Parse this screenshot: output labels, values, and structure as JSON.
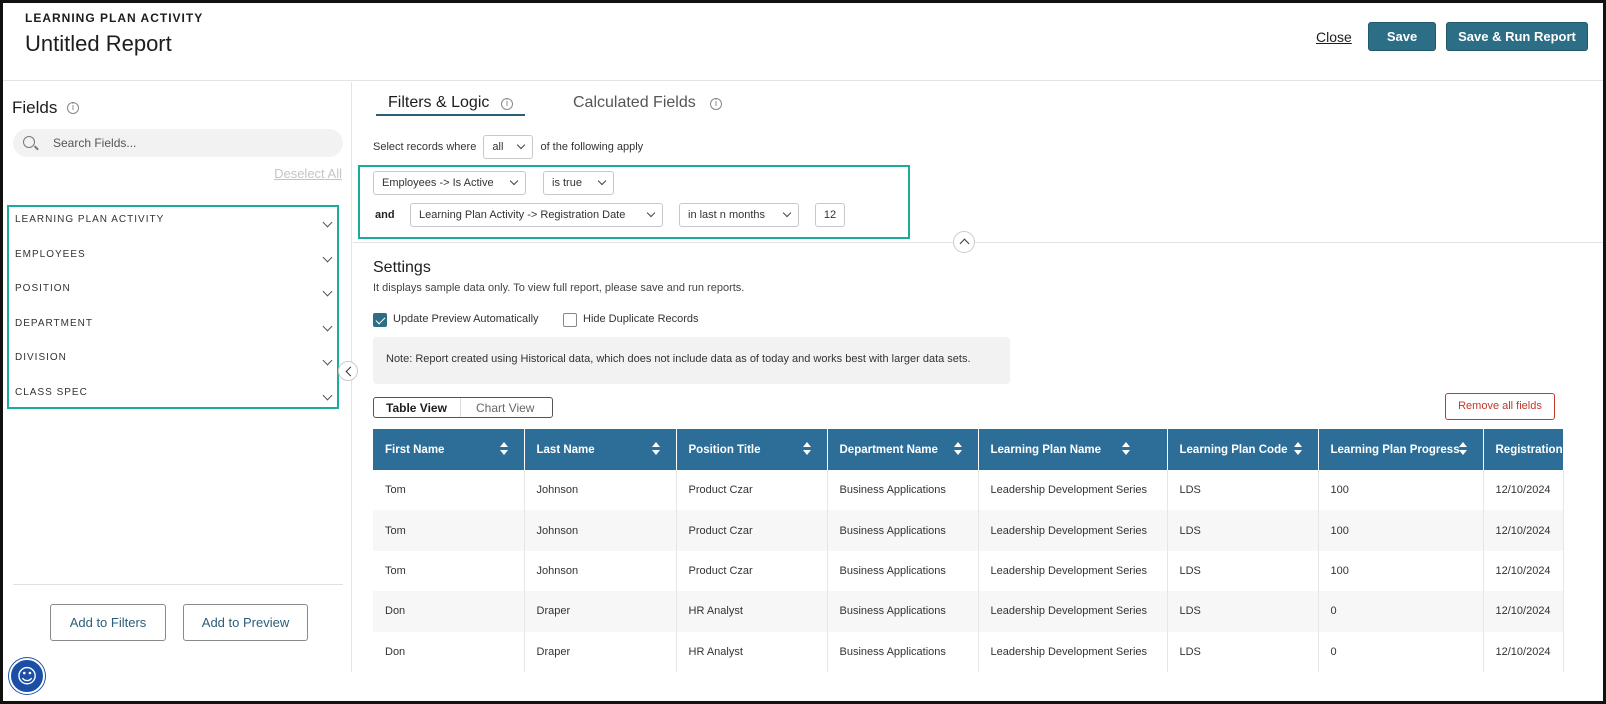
{
  "header": {
    "eyebrow": "LEARNING PLAN ACTIVITY",
    "title": "Untitled Report",
    "close_label": "Close",
    "save_label": "Save",
    "save_run_label": "Save & Run Report"
  },
  "sidebar": {
    "title": "Fields",
    "search_placeholder": "Search Fields...",
    "deselect_label": "Deselect All",
    "groups": [
      "LEARNING PLAN ACTIVITY",
      "EMPLOYEES",
      "POSITION",
      "DEPARTMENT",
      "DIVISION",
      "CLASS SPEC"
    ],
    "add_filters_label": "Add to Filters",
    "add_preview_label": "Add to Preview"
  },
  "tabs": {
    "filters": "Filters & Logic",
    "calculated": "Calculated Fields"
  },
  "filters": {
    "select_prefix": "Select records where",
    "match_value": "all",
    "select_suffix": "of the following apply",
    "row1": {
      "field": "Employees -> Is Active",
      "operator": "is true"
    },
    "connector": "and",
    "row2": {
      "field": "Learning Plan Activity -> Registration Date",
      "operator": "in last n months",
      "value": "12"
    }
  },
  "settings": {
    "title": "Settings",
    "subtitle": "It displays sample data only. To view full report, please save and run reports.",
    "update_preview_label": "Update Preview Automatically",
    "update_preview_checked": true,
    "hide_duplicates_label": "Hide Duplicate Records",
    "hide_duplicates_checked": false,
    "note": "Note: Report created using Historical data, which does not include data as of today and works best with larger data sets."
  },
  "view": {
    "table_label": "Table View",
    "chart_label": "Chart View",
    "remove_label": "Remove all fields"
  },
  "table": {
    "columns": [
      "First Name",
      "Last Name",
      "Position Title",
      "Department Name",
      "Learning Plan Name",
      "Learning Plan Code",
      "Learning Plan Progress",
      "Registration"
    ],
    "rows": [
      [
        "Tom",
        "Johnson",
        "Product Czar",
        "Business Applications",
        "Leadership Development Series",
        "LDS",
        "100",
        "12/10/2024"
      ],
      [
        "Tom",
        "Johnson",
        "Product Czar",
        "Business Applications",
        "Leadership Development Series",
        "LDS",
        "100",
        "12/10/2024"
      ],
      [
        "Tom",
        "Johnson",
        "Product Czar",
        "Business Applications",
        "Leadership Development Series",
        "LDS",
        "100",
        "12/10/2024"
      ],
      [
        "Don",
        "Draper",
        "HR Analyst",
        "Business Applications",
        "Leadership Development Series",
        "LDS",
        "0",
        "12/10/2024"
      ],
      [
        "Don",
        "Draper",
        "HR Analyst",
        "Business Applications",
        "Leadership Development Series",
        "LDS",
        "0",
        "12/10/2024"
      ]
    ]
  },
  "colors": {
    "primary": "#2c6e85",
    "table_header": "#2c6e98",
    "highlight": "#1aab9b",
    "danger": "#c0392b"
  },
  "icons": {
    "fields_info": "info-icon",
    "search": "search-icon",
    "accessibility": "accessibility-icon"
  }
}
